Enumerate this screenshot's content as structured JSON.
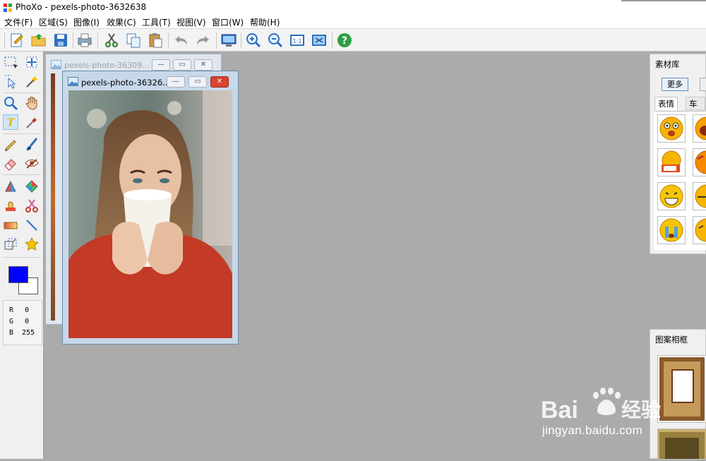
{
  "window": {
    "title": "PhoXo - pexels-photo-3632638"
  },
  "menu": [
    {
      "label": "文件(F)"
    },
    {
      "label": "区域(S)"
    },
    {
      "label": "图像(I)"
    },
    {
      "label": "效果(C)"
    },
    {
      "label": "工具(T)"
    },
    {
      "label": "视图(V)"
    },
    {
      "label": "窗口(W)"
    },
    {
      "label": "帮助(H)"
    }
  ],
  "toolbar": {
    "buttons": [
      "new-icon",
      "open-folder-icon",
      "save-icon",
      "print-icon",
      "cut-icon",
      "copy-icon",
      "paste-icon",
      "undo-icon",
      "redo-icon",
      "capture-screen-icon",
      "zoom-in-icon",
      "zoom-out-icon",
      "actual-size-icon",
      "fit-window-icon",
      "help-icon"
    ]
  },
  "tools": [
    "rect-select-icon",
    "move-icon",
    "pointer-select-icon",
    "magic-wand-icon",
    "zoom-icon",
    "hand-icon",
    "text-icon",
    "eyedropper-icon",
    "pencil-icon",
    "brush-icon",
    "eraser-icon",
    "red-eye-icon",
    "clone-icon",
    "color-replace-icon",
    "stamp-icon",
    "scissors-icon",
    "gradient-icon",
    "line-icon",
    "transform-icon",
    "star-icon"
  ],
  "colors": {
    "foreground": "#0000ff",
    "background": "#ffffff",
    "accent": "#5b8fc9"
  },
  "rgb": [
    {
      "label": "R",
      "value": "0"
    },
    {
      "label": "G",
      "value": "0"
    },
    {
      "label": "B",
      "value": "255"
    }
  ],
  "windows": {
    "back": {
      "title": "pexels-photo-36309..."
    },
    "front": {
      "title": "pexels-photo-36326..."
    },
    "controls": {
      "minimize": "—",
      "restore": "▭",
      "close": "✕"
    }
  },
  "library": {
    "title": "素材库",
    "more_button": "更多",
    "tabs": [
      {
        "label": "表情"
      },
      {
        "label": "车标"
      }
    ]
  },
  "frames": {
    "title": "图案相框"
  },
  "watermark": {
    "brand": "Bai经验",
    "url": "jingyan.baidu.com"
  }
}
